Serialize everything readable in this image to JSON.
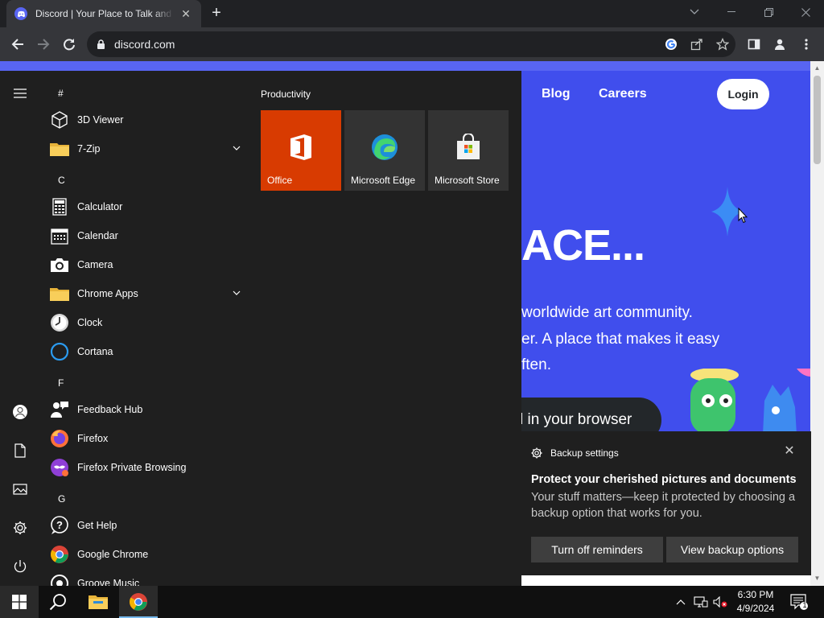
{
  "browser": {
    "tab_title": "Discord | Your Place to Talk and Hang Out",
    "url": "discord.com"
  },
  "page": {
    "nav_links": [
      "Blog",
      "Careers"
    ],
    "login_label": "Login",
    "hero_title": "ACE...",
    "hero_lines": [
      " worldwide art community.",
      "er. A place that makes it easy",
      "ften."
    ],
    "browser_button": "l in your browser",
    "brand_color": "#404eed"
  },
  "start_menu": {
    "apps": [
      {
        "type": "letter",
        "label": "#"
      },
      {
        "type": "app",
        "label": "3D Viewer",
        "icon": "cube-icon"
      },
      {
        "type": "app",
        "label": "7-Zip",
        "icon": "folder-icon",
        "expandable": true
      },
      {
        "type": "letter",
        "label": "C"
      },
      {
        "type": "app",
        "label": "Calculator",
        "icon": "calculator-icon"
      },
      {
        "type": "app",
        "label": "Calendar",
        "icon": "calendar-icon"
      },
      {
        "type": "app",
        "label": "Camera",
        "icon": "camera-icon"
      },
      {
        "type": "app",
        "label": "Chrome Apps",
        "icon": "folder-icon",
        "expandable": true
      },
      {
        "type": "app",
        "label": "Clock",
        "icon": "clock-icon"
      },
      {
        "type": "app",
        "label": "Cortana",
        "icon": "cortana-icon"
      },
      {
        "type": "letter",
        "label": "F"
      },
      {
        "type": "app",
        "label": "Feedback Hub",
        "icon": "feedback-icon"
      },
      {
        "type": "app",
        "label": "Firefox",
        "icon": "firefox-icon"
      },
      {
        "type": "app",
        "label": "Firefox Private Browsing",
        "icon": "firefox-private-icon"
      },
      {
        "type": "letter",
        "label": "G"
      },
      {
        "type": "app",
        "label": "Get Help",
        "icon": "help-icon"
      },
      {
        "type": "app",
        "label": "Google Chrome",
        "icon": "chrome-icon"
      },
      {
        "type": "app",
        "label": "Groove Music",
        "icon": "music-icon"
      }
    ],
    "group_title": "Productivity",
    "tiles": [
      {
        "label": "Office",
        "color": "#d83b01",
        "icon": "office-icon"
      },
      {
        "label": "Microsoft Edge",
        "color": "#333333",
        "icon": "edge-icon"
      },
      {
        "label": "Microsoft Store",
        "color": "#333333",
        "icon": "store-icon"
      }
    ]
  },
  "toast": {
    "app_name": "Backup settings",
    "title": "Protect your cherished pictures and documents",
    "body": "Your stuff matters—keep it protected by choosing a backup option that works for you.",
    "buttons": [
      "Turn off reminders",
      "View backup options"
    ]
  },
  "taskbar": {
    "time": "6:30 PM",
    "date": "4/9/2024",
    "notification_count": "1"
  }
}
